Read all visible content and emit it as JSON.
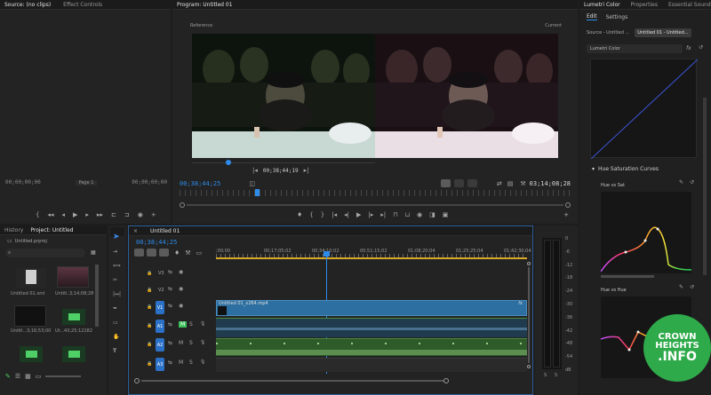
{
  "source_panel": {
    "tab_source": "Source: (no clips)",
    "tab_effect_controls": "Effect Controls",
    "timecode": "00;00;00;00",
    "page": "Page 1",
    "timecode_right": "00;00;00;00"
  },
  "program_panel": {
    "title": "Program: Untitled 01",
    "reference_label": "Reference",
    "current_label": "Current",
    "ref_timecode": "00;38;44;19",
    "timecode": "00;38;44;25",
    "duration": "03;14;08;28"
  },
  "lumetri_panel": {
    "tab_lumetri": "Lumetri Color",
    "tab_properties": "Properties",
    "tab_essential_sound": "Essential Sound",
    "subtab_edit": "Edit",
    "subtab_settings": "Settings",
    "source_button": "Source - Untitled ...",
    "sequence_button": "Untitled 01 - Untitled...",
    "effect_select": "Lumetri Color",
    "fx_label": "fx",
    "section_title": "Hue Saturation Curves",
    "curve1_label": "Hue vs Sat",
    "curve2_label": "Hue vs Hue"
  },
  "project_panel": {
    "tab_history": "History",
    "tab_project": "Project: Untitled",
    "project_file": "Untitled.prproj",
    "items": [
      {
        "name": "Untitled 01.xml",
        "duration": ""
      },
      {
        "name": "Untitl...",
        "duration": "3;14;08;28"
      },
      {
        "name": "Untitl...",
        "duration": "3;16;53;00"
      },
      {
        "name": "Ut...",
        "duration": ""
      },
      {
        "name": "",
        "duration": "43;25;12282"
      }
    ]
  },
  "timeline_panel": {
    "tab": "Untitled 01",
    "timecode": "00;38;44;25",
    "ruler_labels": [
      ";00;00",
      "00;17;05;02",
      "00;34;10;02",
      "00;51;15;02",
      "01;08;20;04",
      "01;25;25;04",
      "01;42;30;04"
    ],
    "video_tracks": [
      "V3",
      "V2",
      "V1"
    ],
    "audio_tracks": [
      "A1",
      "A2",
      "A3"
    ],
    "clip_name": "Untitled 01_x264.mp4",
    "fx_label": "fx"
  },
  "meter": {
    "labels": [
      "0",
      "-6",
      "-12",
      "-18",
      "-24",
      "-30",
      "-36",
      "-42",
      "-48",
      "-54",
      "dB"
    ],
    "solo_labels": [
      "S",
      "S"
    ]
  },
  "watermark": {
    "line1": "CROWN",
    "line2": "HEIGHTS",
    "line3": ".INFO"
  },
  "colors": {
    "accent": "#2d8ceb",
    "video_clip": "#2d6fa0",
    "audio_clip": "#2f5b2a",
    "watermark": "#2faa4a"
  }
}
